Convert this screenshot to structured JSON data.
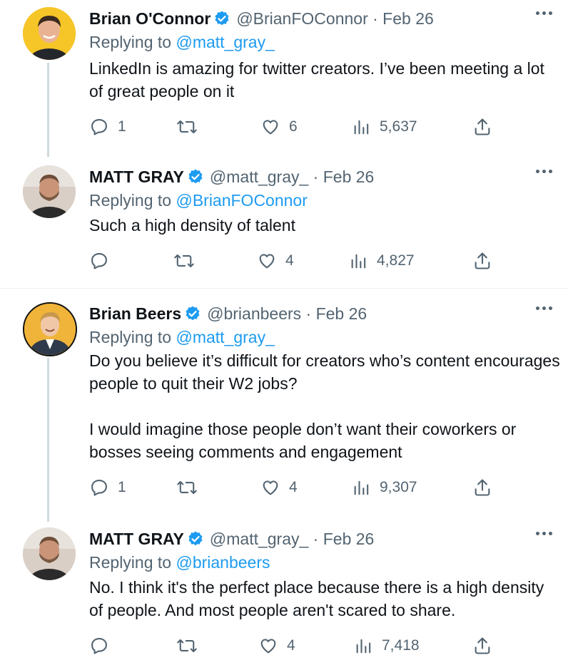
{
  "tweets": [
    {
      "name": "Brian O'Connor",
      "handle_date": "@BrianFOConnor · Feb 26",
      "replying_prefix": "Replying to",
      "replying_to": "@matt_gray_",
      "body": [
        "LinkedIn is amazing for twitter creators. I’ve been meeting a lot of great people on it"
      ],
      "reply_count": "1",
      "retweet_count": "",
      "like_count": "6",
      "view_count": "5,637",
      "avatar_bg": "#f6c528"
    },
    {
      "name": "MATT GRAY",
      "handle_date": "@matt_gray_ · Feb 26",
      "replying_prefix": "Replying to",
      "replying_to": "@BrianFOConnor",
      "body": [
        "Such a high density of talent"
      ],
      "reply_count": "",
      "retweet_count": "",
      "like_count": "4",
      "view_count": "4,827",
      "avatar_bg": "#d9cfc6"
    },
    {
      "name": "Brian Beers",
      "handle_date": "@brianbeers · Feb 26",
      "replying_prefix": "Replying to",
      "replying_to": "@matt_gray_",
      "body": [
        "Do you believe it’s difficult for creators who’s content encourages people to quit their W2 jobs?",
        "I would imagine those people don’t want their coworkers or bosses seeing comments and engagement"
      ],
      "reply_count": "1",
      "retweet_count": "",
      "like_count": "4",
      "view_count": "9,307",
      "avatar_bg": "#f0b43a"
    },
    {
      "name": "MATT GRAY",
      "handle_date": "@matt_gray_ · Feb 26",
      "replying_prefix": "Replying to",
      "replying_to": "@brianbeers",
      "body": [
        "No. I think it's the perfect place because there is a high density of people. And most people aren't scared to share."
      ],
      "reply_count": "",
      "retweet_count": "",
      "like_count": "4",
      "view_count": "7,418",
      "avatar_bg": "#d9cfc6"
    }
  ],
  "colors": {
    "text": "#0f1419",
    "secondary": "#536471",
    "link": "#1d9bf0",
    "verified": "#1d9bf0",
    "thread_line": "#cfd9de"
  },
  "icons": {
    "reply": "reply-icon",
    "retweet": "retweet-icon",
    "like": "heart-icon",
    "views": "views-icon",
    "share": "share-icon",
    "verified": "verified-badge-icon",
    "more": "more-icon"
  }
}
